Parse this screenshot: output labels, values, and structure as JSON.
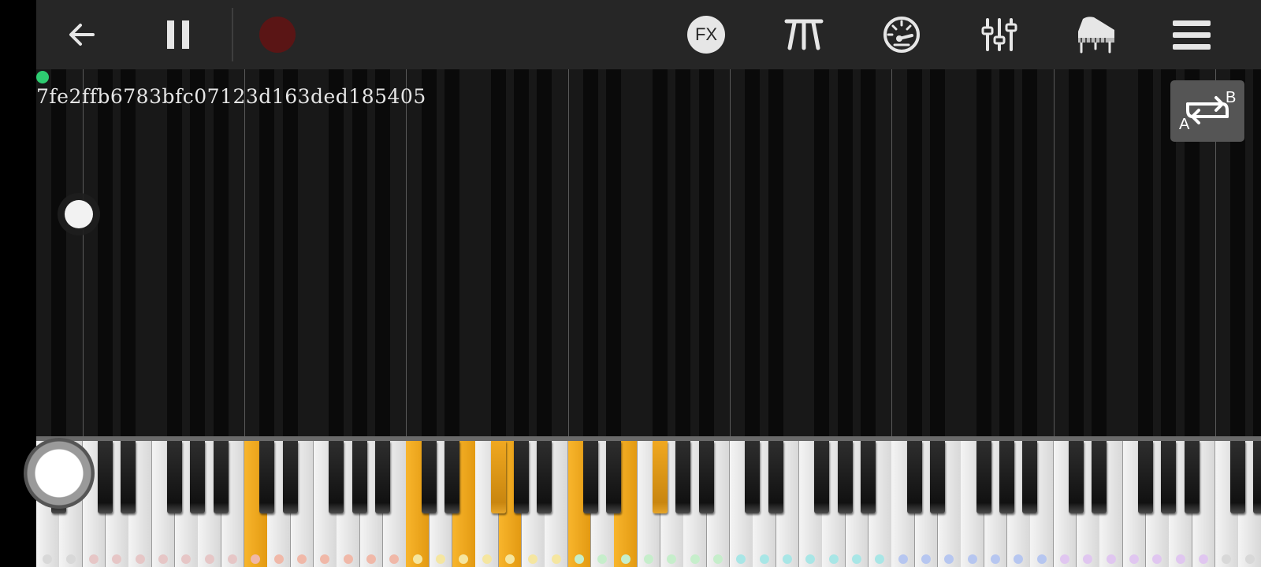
{
  "toolbar": {
    "icons": {
      "back": "arrow-left-icon",
      "pause": "pause-icon",
      "record": "record-icon",
      "fx": "fx-icon",
      "metronome": "metronome-icon",
      "tempo": "speedometer-icon",
      "mixer": "sliders-icon",
      "instrument": "grand-piano-icon",
      "menu": "hamburger-menu-icon"
    },
    "fx_label": "FX",
    "record_color": "#5a1515"
  },
  "song": {
    "title": "7fe2ffb6783bfc07123d163ded185405"
  },
  "loop": {
    "label_a": "A",
    "label_b": "B"
  },
  "keyboard": {
    "highlight_color": "#f5ac22",
    "visible_white_keys": 53,
    "label_colors": [
      "#d8d8d8",
      "#d8d8d8",
      "#e6c6c6",
      "#e6c6c6",
      "#e6c6c6",
      "#e6c6c6",
      "#e6c6c6",
      "#e6c6c6",
      "#e6c6c6",
      "#f0b8a8",
      "#f0b8a8",
      "#f0b8a8",
      "#f0b8a8",
      "#f0b8a8",
      "#f0b8a8",
      "#f0b8a8",
      "#f5e6a0",
      "#f5e6a0",
      "#f5e6a0",
      "#f5e6a0",
      "#f5e6a0",
      "#f5e6a0",
      "#f5e6a0",
      "#c6eecb",
      "#c6eecb",
      "#c6eecb",
      "#c6eecb",
      "#c6eecb",
      "#c6eecb",
      "#c6eecb",
      "#a8e6e6",
      "#a8e6e6",
      "#a8e6e6",
      "#a8e6e6",
      "#a8e6e6",
      "#a8e6e6",
      "#a8e6e6",
      "#b6c6f0",
      "#b6c6f0",
      "#b6c6f0",
      "#b6c6f0",
      "#b6c6f0",
      "#b6c6f0",
      "#b6c6f0",
      "#e0c6f0",
      "#e0c6f0",
      "#e0c6f0",
      "#e0c6f0",
      "#e0c6f0",
      "#e0c6f0",
      "#e0c6f0",
      "#d8d8d8",
      "#d8d8d8"
    ],
    "highlighted_white": [
      9,
      16,
      18,
      20,
      23,
      25
    ],
    "highlighted_black": [
      19,
      25,
      26
    ]
  }
}
